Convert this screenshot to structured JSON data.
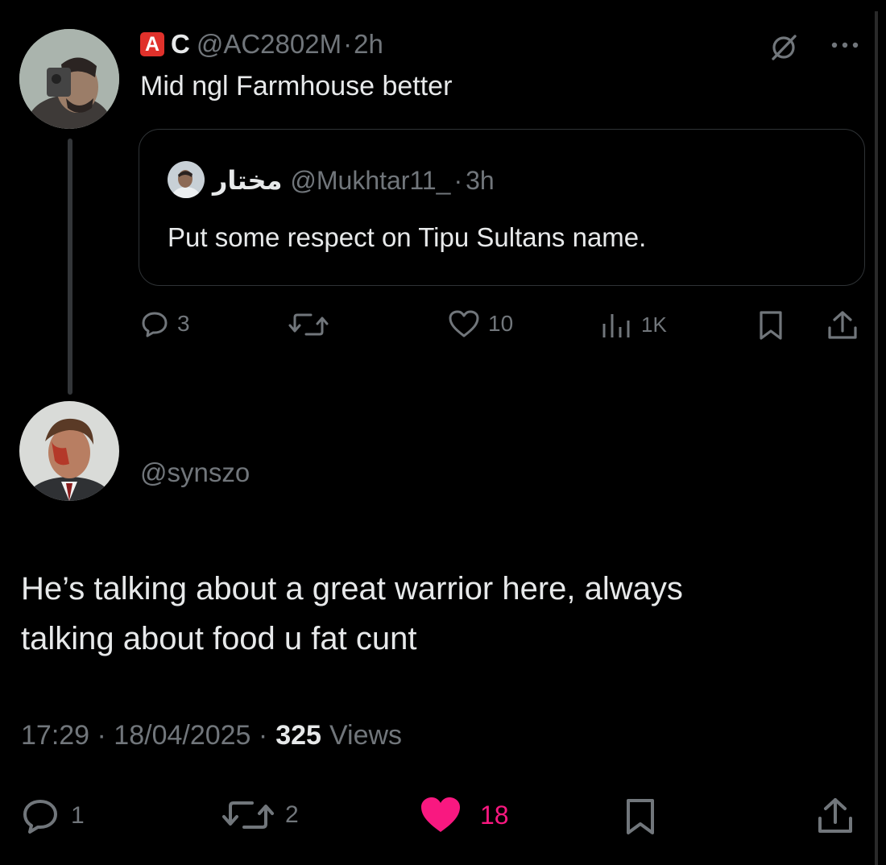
{
  "parent": {
    "display_name": "C",
    "flag_letter": "A",
    "handle": "@AC2802M",
    "separator": "·",
    "time": "2h",
    "text": "Mid ngl Farmhouse better",
    "quote": {
      "display_name": "مختار",
      "handle": "@Mukhtar11_",
      "separator": "·",
      "time": "3h",
      "text": "Put some respect on Tipu Sultans name."
    },
    "actions": {
      "replies": "3",
      "likes": "10",
      "views": "1K"
    }
  },
  "reply": {
    "handle": "@synszo",
    "text_line1": "He’s talking about a great warrior here, always",
    "text_line2": "talking about food u fat cunt",
    "timestamp": "17:29 · 18/04/2025 ·",
    "views_count": "325",
    "views_label": "Views",
    "actions": {
      "replies": "1",
      "reposts": "2",
      "likes": "18"
    }
  },
  "colors": {
    "background": "#000000",
    "text": "#e7e9ea",
    "muted": "#71767b",
    "like_active": "#f91880",
    "flag_red": "#e0312b"
  },
  "icons": [
    "grok-icon",
    "more-icon",
    "reply-icon",
    "repost-icon",
    "like-icon",
    "views-icon",
    "bookmark-icon",
    "share-icon"
  ]
}
